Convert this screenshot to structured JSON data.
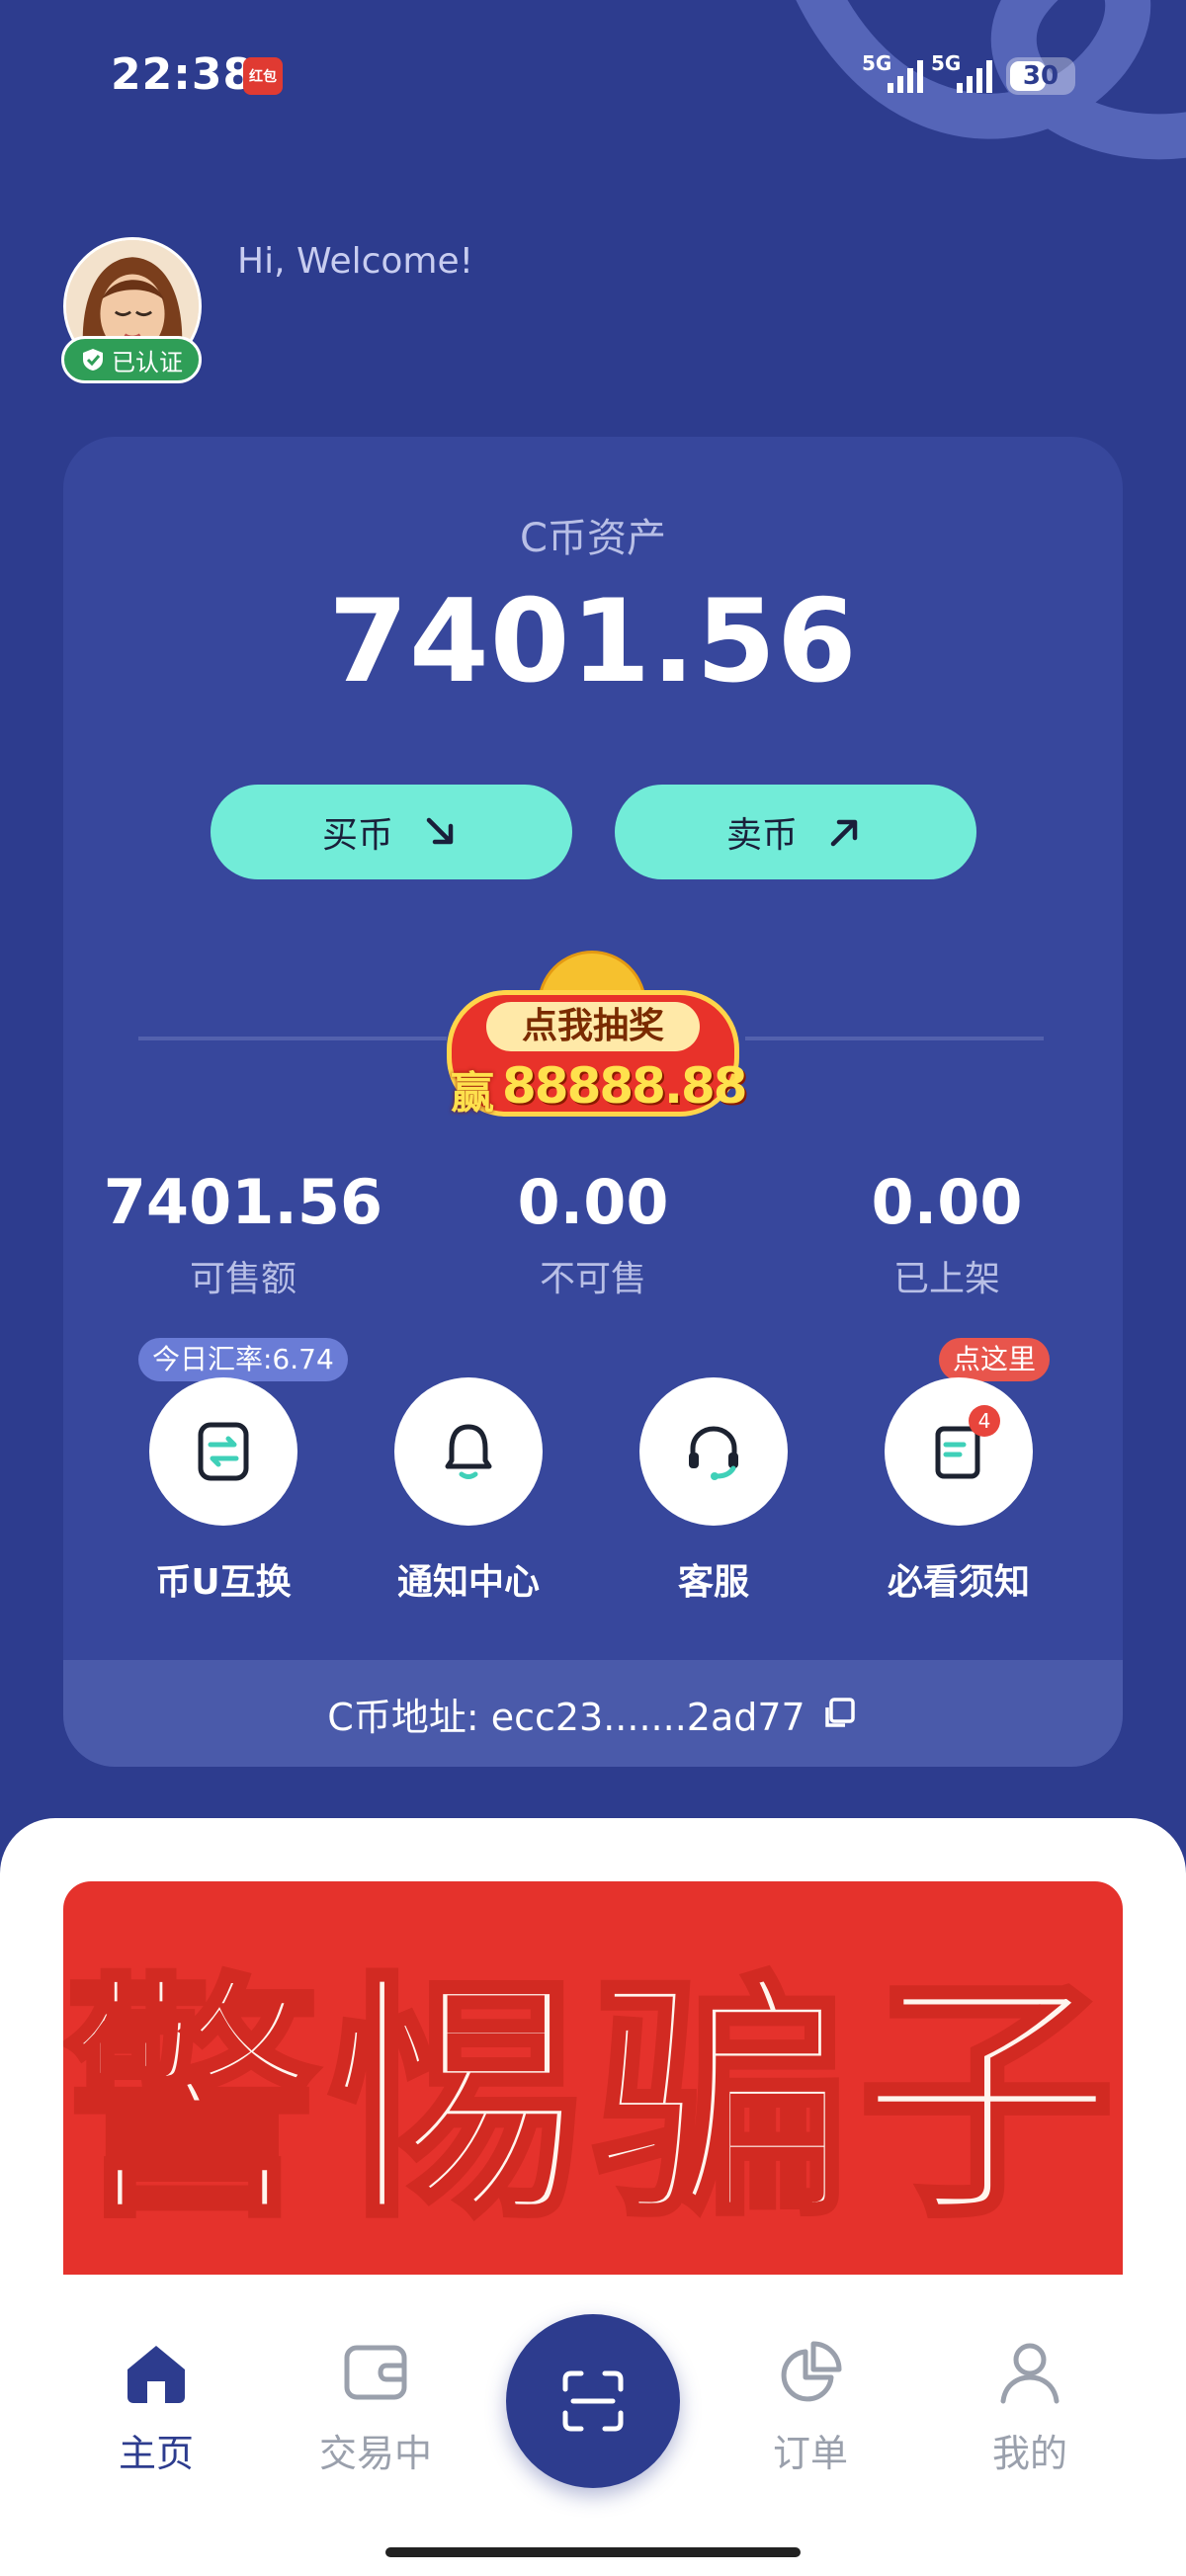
{
  "status_bar": {
    "time": "22:38",
    "app_badge": "红包",
    "signal_1": "5G",
    "signal_2": "5G",
    "battery": "30"
  },
  "header": {
    "welcome": "Hi, Welcome!",
    "verified": "已认证"
  },
  "asset_card": {
    "title": "C币资产",
    "amount": "7401.56",
    "buy_label": "买币",
    "sell_label": "卖币",
    "lottery": {
      "label": "点我抽奖",
      "win": "赢",
      "prize": "88888.88"
    },
    "stats": [
      {
        "value": "7401.56",
        "label": "可售额"
      },
      {
        "value": "0.00",
        "label": "不可售"
      },
      {
        "value": "0.00",
        "label": "已上架"
      }
    ],
    "quick_actions": [
      {
        "label": "币U互换",
        "icon": "exchange-icon",
        "tag": "今日汇率:6.74"
      },
      {
        "label": "通知中心",
        "icon": "bell-icon"
      },
      {
        "label": "客服",
        "icon": "headset-icon"
      },
      {
        "label": "必看须知",
        "icon": "document-icon",
        "tag": "点这里",
        "badge": "4"
      }
    ],
    "address": "C币地址: ecc23.......2ad77"
  },
  "banner": {
    "text": "警惕骗子"
  },
  "tabbar": {
    "items": [
      {
        "label": "主页",
        "icon": "home-icon",
        "active": true
      },
      {
        "label": "交易中",
        "icon": "wallet-icon",
        "active": false
      },
      {
        "label": "订单",
        "icon": "pie-chart-icon",
        "active": false
      },
      {
        "label": "我的",
        "icon": "profile-icon",
        "active": false
      }
    ],
    "center_icon": "scan-icon"
  },
  "colors": {
    "background": "#2d3c8e",
    "card": "#37479c",
    "accent_mint": "#72ecd8",
    "banner_red": "#e5322c",
    "verified_green": "#2f9e57",
    "tab_active": "#2d3c8e",
    "tab_inactive": "#9aa0ac"
  }
}
